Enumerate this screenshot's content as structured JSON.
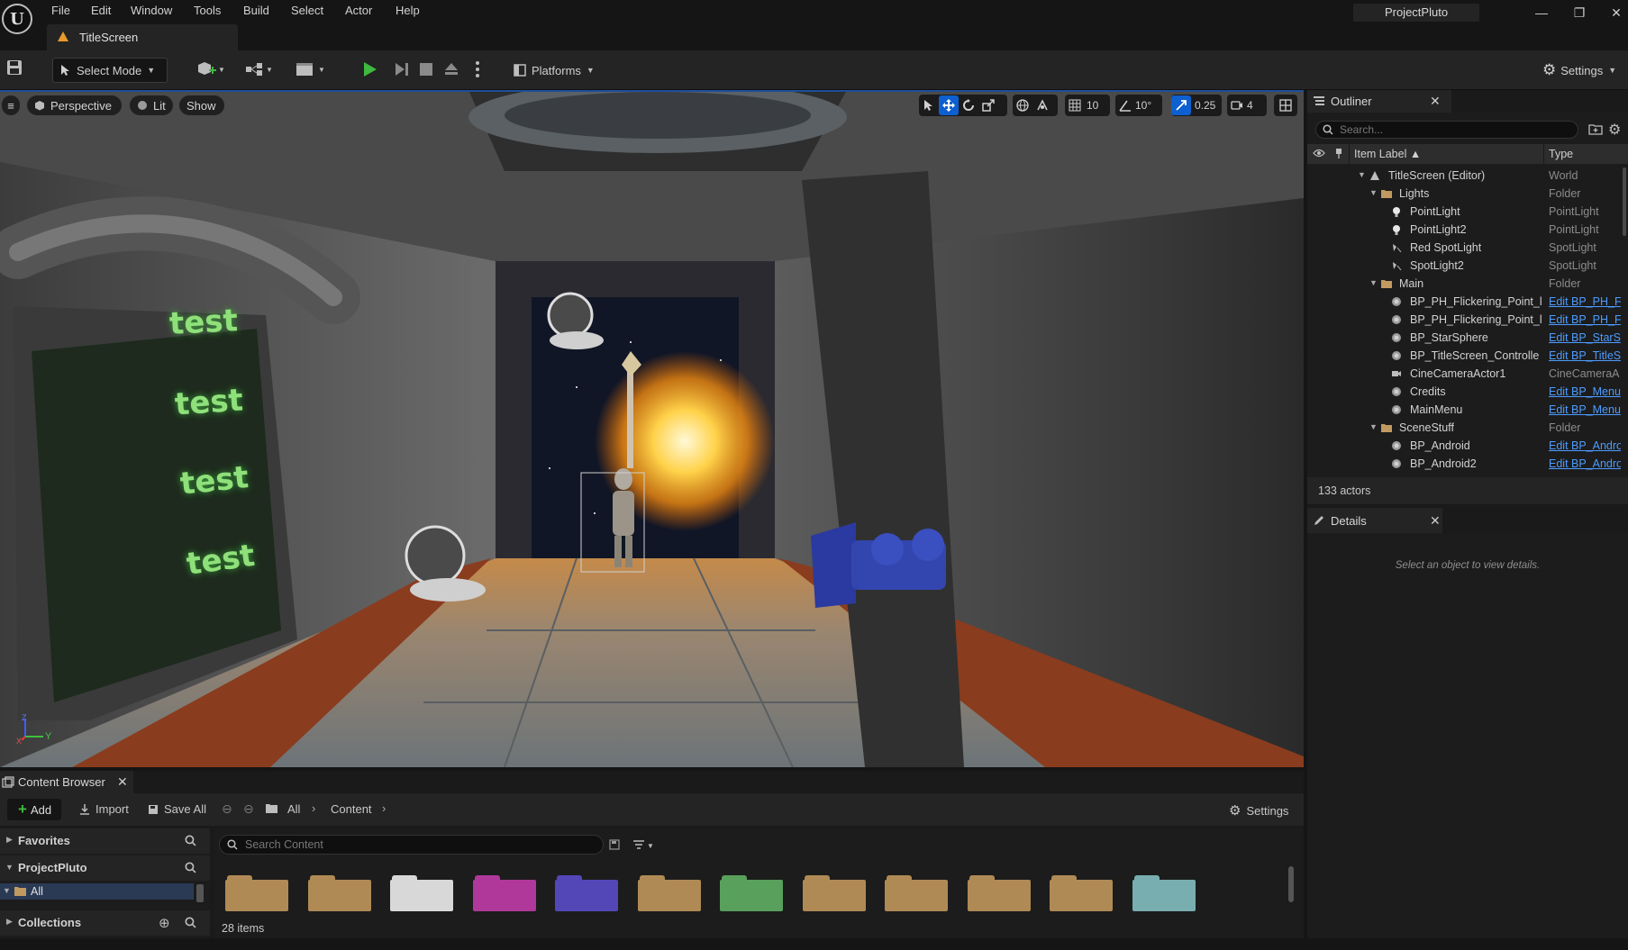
{
  "app": {
    "logo_letter": "U",
    "menu": [
      "File",
      "Edit",
      "Window",
      "Tools",
      "Build",
      "Select",
      "Actor",
      "Help"
    ],
    "project_name": "ProjectPluto",
    "window_controls": {
      "minimize": "—",
      "restore": "❐",
      "close": "✕"
    }
  },
  "level_tab": {
    "label": "TitleScreen",
    "icon": "level-icon",
    "accent": "#e89a2c"
  },
  "toolbar": {
    "select_mode": "Select Mode",
    "platforms": "Platforms",
    "settings": "Settings",
    "play_color": "#3fb93f"
  },
  "viewport": {
    "perspective": "Perspective",
    "lit": "Lit",
    "show": "Show",
    "grid_snap": "10",
    "rotation_snap": "10°",
    "scale_snap": "0.25",
    "camera_speed": "4",
    "monitor_texts": [
      "test",
      "test",
      "test",
      "test"
    ],
    "axis_y": "Y",
    "axis_z": "Z",
    "axis_x": "X"
  },
  "outliner": {
    "title": "Outliner",
    "search_placeholder": "Search...",
    "col_label": "Item Label ▲",
    "col_type": "Type",
    "rows": [
      {
        "name": "TitleScreen (Editor)",
        "type": "World",
        "link": false,
        "indent": 0
      },
      {
        "name": "Lights",
        "type": "Folder",
        "link": false,
        "indent": 1
      },
      {
        "name": "PointLight",
        "type": "PointLight",
        "link": false,
        "indent": 2
      },
      {
        "name": "PointLight2",
        "type": "PointLight",
        "link": false,
        "indent": 2
      },
      {
        "name": "Red SpotLight",
        "type": "SpotLight",
        "link": false,
        "indent": 2
      },
      {
        "name": "SpotLight2",
        "type": "SpotLight",
        "link": false,
        "indent": 2
      },
      {
        "name": "Main",
        "type": "Folder",
        "link": false,
        "indent": 1
      },
      {
        "name": "BP_PH_Flickering_Point_l",
        "type": "Edit BP_PH_F",
        "link": true,
        "indent": 2
      },
      {
        "name": "BP_PH_Flickering_Point_l",
        "type": "Edit BP_PH_F",
        "link": true,
        "indent": 2
      },
      {
        "name": "BP_StarSphere",
        "type": "Edit BP_StarS",
        "link": true,
        "indent": 2
      },
      {
        "name": "BP_TitleScreen_Controlle",
        "type": "Edit BP_TitleS",
        "link": true,
        "indent": 2
      },
      {
        "name": "CineCameraActor1",
        "type": "CineCameraA",
        "link": false,
        "indent": 2
      },
      {
        "name": "Credits",
        "type": "Edit BP_Menu",
        "link": true,
        "indent": 2
      },
      {
        "name": "MainMenu",
        "type": "Edit BP_Menu",
        "link": true,
        "indent": 2
      },
      {
        "name": "SceneStuff",
        "type": "Folder",
        "link": false,
        "indent": 1
      },
      {
        "name": "BP_Android",
        "type": "Edit BP_Andro",
        "link": true,
        "indent": 2
      },
      {
        "name": "BP_Android2",
        "type": "Edit BP_Andro",
        "link": true,
        "indent": 2
      }
    ],
    "actor_count": "133 actors"
  },
  "details": {
    "title": "Details",
    "empty_message": "Select an object to view details."
  },
  "content_browser": {
    "title": "Content Browser",
    "add": "Add",
    "import": "Import",
    "save_all": "Save All",
    "breadcrumb": [
      "All",
      "Content"
    ],
    "settings": "Settings",
    "search_placeholder": "Search Content",
    "favorites": "Favorites",
    "project": "ProjectPluto",
    "tree_all": "All",
    "collections": "Collections",
    "item_count": "28 items",
    "folder_colors": [
      "#b08a55",
      "#b08a55",
      "#d8d8d8",
      "#b0389a",
      "#5347b8",
      "#b08a55",
      "#58a05c",
      "#b08a55",
      "#b08a55",
      "#b08a55",
      "#b08a55",
      "#79aeb0"
    ]
  }
}
